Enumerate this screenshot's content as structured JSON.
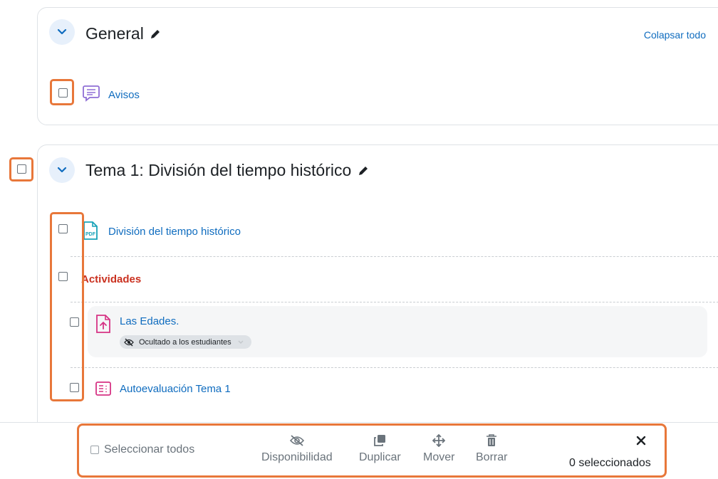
{
  "general": {
    "title": "General",
    "collapse_all": "Colapsar todo",
    "items": [
      {
        "label": "Avisos",
        "icon": "forum-icon"
      }
    ]
  },
  "tema1": {
    "title": "Tema 1: División del tiempo histórico",
    "items": [
      {
        "label": "División del tiempo histórico",
        "icon": "pdf-file-icon"
      },
      {
        "label": "Actividades",
        "type": "subsection"
      },
      {
        "label": "Las Edades.",
        "icon": "assignment-icon",
        "badge": "Ocultado a los estudiantes"
      },
      {
        "label": "Autoevaluación Tema 1",
        "icon": "quiz-icon"
      }
    ]
  },
  "bulk": {
    "select_all": "Seleccionar todos",
    "actions": [
      {
        "label": "Disponibilidad",
        "icon": "eye-slash-icon"
      },
      {
        "label": "Duplicar",
        "icon": "copy-icon"
      },
      {
        "label": "Mover",
        "icon": "move-icon"
      },
      {
        "label": "Borrar",
        "icon": "trash-icon"
      }
    ],
    "selected_count": "0 seleccionados"
  },
  "colors": {
    "link": "#0f6cbf",
    "highlight": "#e8773a",
    "subsection": "#ca3120",
    "pink_icon": "#d63384",
    "purple_icon": "#8f6ed5"
  }
}
